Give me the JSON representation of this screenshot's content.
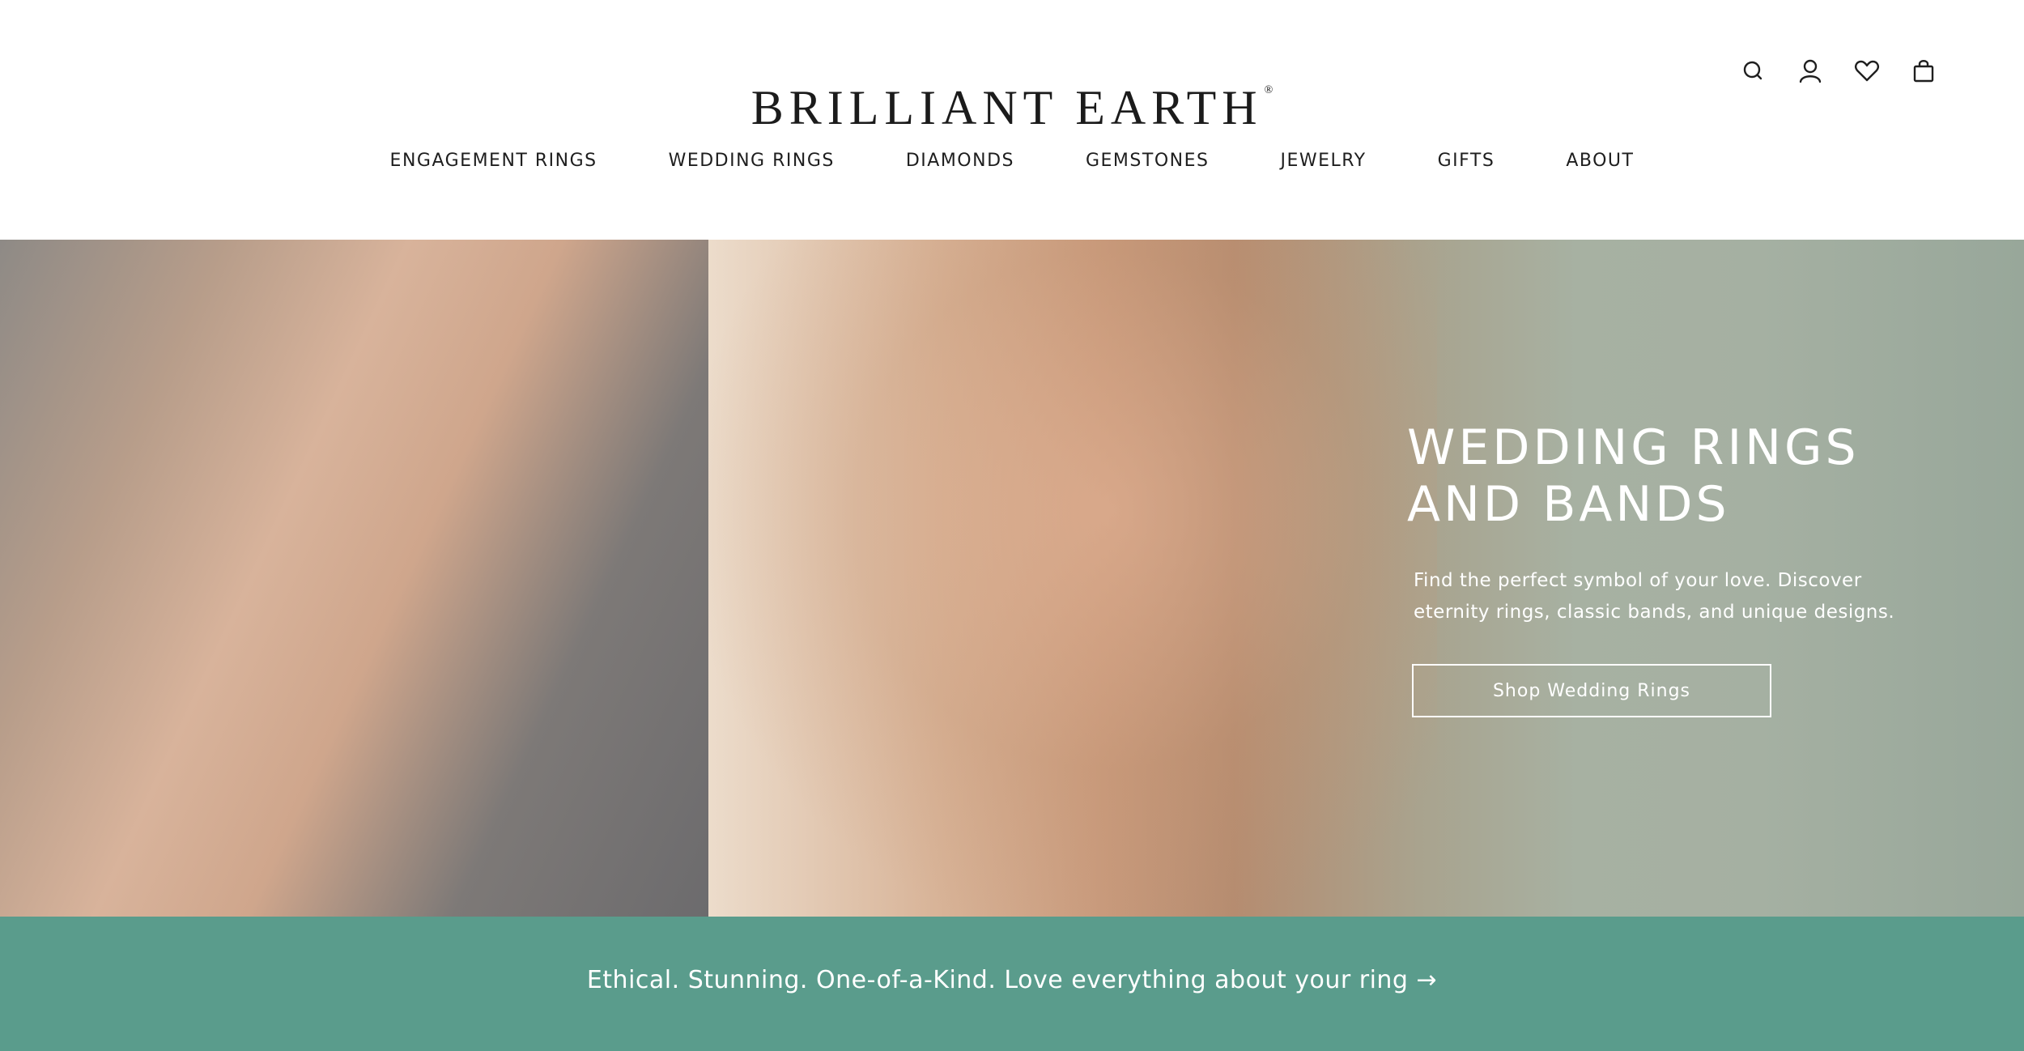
{
  "header": {
    "logo": "BRILLIANT EARTH",
    "logo_mark": "®",
    "utility_icons": [
      "search-icon",
      "account-icon",
      "wishlist-heart-icon",
      "shopping-bag-icon"
    ]
  },
  "nav": {
    "items": [
      {
        "label": "ENGAGEMENT RINGS"
      },
      {
        "label": "WEDDING RINGS"
      },
      {
        "label": "DIAMONDS"
      },
      {
        "label": "GEMSTONES"
      },
      {
        "label": "JEWELRY"
      },
      {
        "label": "GIFTS"
      },
      {
        "label": "ABOUT"
      }
    ]
  },
  "hero": {
    "title_line1": "WEDDING RINGS",
    "title_line2": "AND BANDS",
    "subtitle": "Find the perfect symbol of your love. Discover eternity rings, classic bands, and unique designs.",
    "cta_label": "Shop Wedding Rings"
  },
  "promo": {
    "text": "Ethical. Stunning. One-of-a-Kind. Love everything about your ring →"
  },
  "colors": {
    "promo_band": "#5a9c8c",
    "text_dark": "#1f1f1f",
    "hero_text": "#ffffff"
  }
}
